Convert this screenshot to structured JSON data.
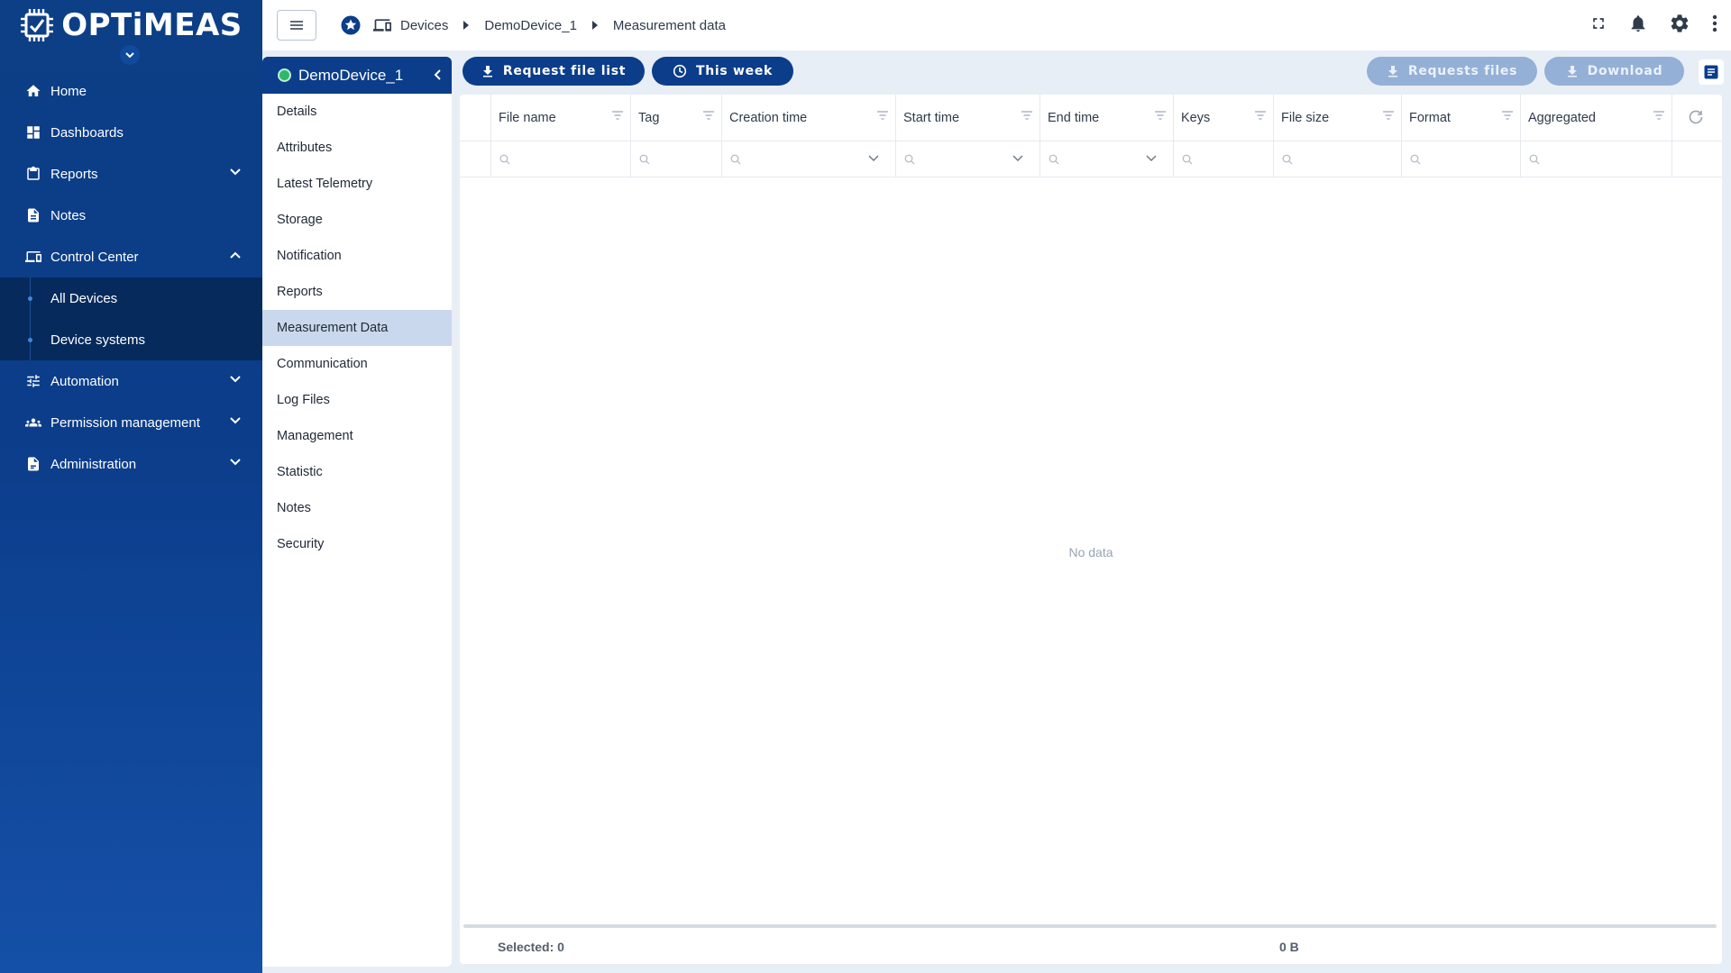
{
  "app": {
    "logo_text": "OPTiMEAS"
  },
  "sidebar": {
    "items": [
      {
        "label": "Home",
        "icon": "home-icon"
      },
      {
        "label": "Dashboards",
        "icon": "dashboard-icon"
      },
      {
        "label": "Reports",
        "icon": "clipboard-icon"
      },
      {
        "label": "Notes",
        "icon": "note-icon"
      },
      {
        "label": "Control Center",
        "icon": "devices-icon"
      },
      {
        "label": "All Devices"
      },
      {
        "label": "Device systems"
      },
      {
        "label": "Automation",
        "icon": "tune-icon"
      },
      {
        "label": "Permission management",
        "icon": "people-icon"
      },
      {
        "label": "Administration",
        "icon": "admin-icon"
      }
    ]
  },
  "breadcrumb": {
    "devices": "Devices",
    "device": "DemoDevice_1",
    "page": "Measurement data"
  },
  "device_panel": {
    "title": "DemoDevice_1",
    "items": [
      "Details",
      "Attributes",
      "Latest Telemetry",
      "Storage",
      "Notification",
      "Reports",
      "Measurement Data",
      "Communication",
      "Log Files",
      "Management",
      "Statistic",
      "Notes",
      "Security"
    ],
    "active": "Measurement Data"
  },
  "toolbar": {
    "request_file_list": "Request file list",
    "time_range": "This week",
    "requests_files": "Requests files",
    "download": "Download"
  },
  "table": {
    "columns": [
      "File name",
      "Tag",
      "Creation time",
      "Start time",
      "End time",
      "Keys",
      "File size",
      "Format",
      "Aggregated"
    ],
    "empty_text": "No data",
    "selected_label": "Selected: 0",
    "total_size": "0 B"
  },
  "colors": {
    "brand": "#0b3d8a",
    "nav_bg": "#0d3f86",
    "active_item": "#c9d8ec",
    "disabled_button": "#94b0d6"
  }
}
